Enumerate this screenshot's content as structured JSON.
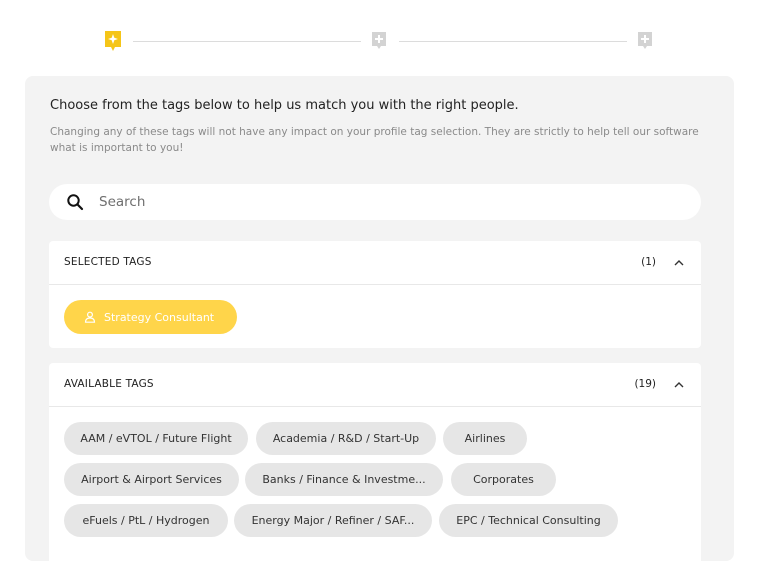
{
  "stepper": {
    "steps": [
      {
        "icon": "sparkle-bookmark-icon",
        "state": "active",
        "color": "#f5c518"
      },
      {
        "icon": "plus-bookmark-icon",
        "state": "inactive",
        "color": "#cfcfcf"
      },
      {
        "icon": "plus-bookmark-icon",
        "state": "inactive",
        "color": "#cfcfcf"
      }
    ]
  },
  "main": {
    "heading": "Choose from the tags below to help us match you with the right people.",
    "subtext": "Changing any of these tags will not have any impact on your profile tag selection. They are strictly to help tell our software what is important to you!"
  },
  "search": {
    "placeholder": "Search",
    "icon": "search-icon"
  },
  "selected": {
    "title": "SELECTED TAGS",
    "count": "(1)",
    "tags": [
      {
        "label": "Strategy Consultant",
        "icon": "user-icon",
        "color": "#ffd54a"
      }
    ]
  },
  "available": {
    "title": "AVAILABLE TAGS",
    "count": "(19)",
    "tags": [
      {
        "label": "AAM / eVTOL / Future Flight"
      },
      {
        "label": "Academia / R&D / Start-Up"
      },
      {
        "label": "Airlines"
      },
      {
        "label": "Airport & Airport Services"
      },
      {
        "label": "Banks / Finance & Investme..."
      },
      {
        "label": "Corporates"
      },
      {
        "label": "eFuels / PtL / Hydrogen"
      },
      {
        "label": "Energy Major / Refiner / SAF..."
      },
      {
        "label": "EPC / Technical Consulting"
      }
    ]
  },
  "colors": {
    "accent": "#f5c518",
    "selected_tag": "#ffd54a",
    "tag_bg": "#e6e6e6",
    "card_bg": "#f3f3f3"
  }
}
